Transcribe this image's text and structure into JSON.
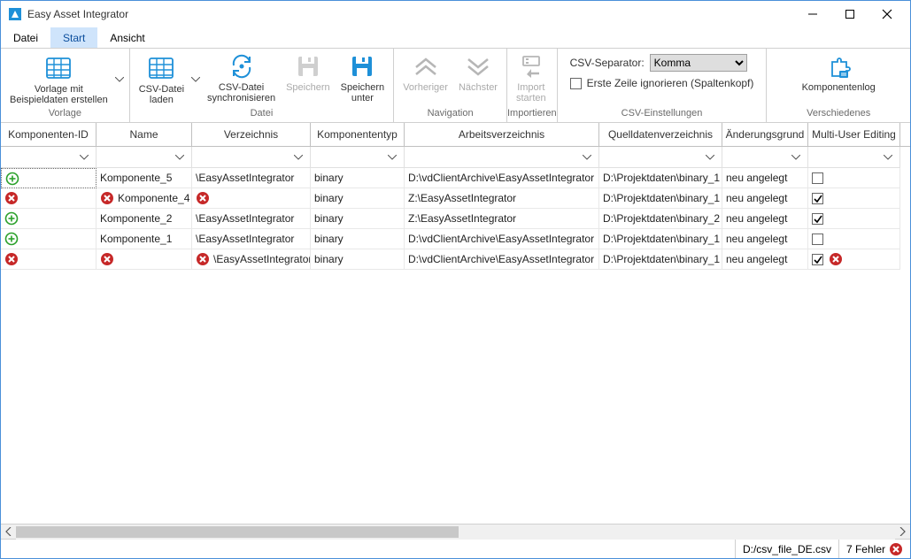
{
  "window": {
    "title": "Easy Asset Integrator"
  },
  "menu": {
    "items": [
      "Datei",
      "Start",
      "Ansicht"
    ],
    "active": 1
  },
  "ribbon": {
    "groups": {
      "vorlage": {
        "caption": "Vorlage",
        "btn_template": "Vorlage mit\nBeispieldaten erstellen"
      },
      "datei": {
        "caption": "Datei",
        "btn_load": "CSV-Datei\nladen",
        "btn_sync": "CSV-Datei\nsynchronisieren",
        "btn_save": "Speichern",
        "btn_saveas": "Speichern\nunter"
      },
      "nav": {
        "caption": "Navigation",
        "btn_prev": "Vorheriger",
        "btn_next": "Nächster"
      },
      "import": {
        "caption": "Importieren",
        "btn_start": "Import\nstarten"
      },
      "csv": {
        "caption": "CSV-Einstellungen",
        "sep_label": "CSV-Separator:",
        "sep_value": "Komma",
        "skip_label": "Erste Zeile ignorieren (Spaltenkopf)"
      },
      "misc": {
        "caption": "Verschiedenes",
        "btn_log": "Komponentenlog"
      }
    }
  },
  "grid": {
    "columns": {
      "id": "Komponenten-ID",
      "name": "Name",
      "dir": "Verzeichnis",
      "type": "Komponententyp",
      "work": "Arbeitsverzeichnis",
      "src": "Quelldatenverzeichnis",
      "reason": "Änderungsgrund",
      "multi": "Multi-User Editing"
    },
    "rows": [
      {
        "status": "plus",
        "name_icon": "",
        "name": "Komponente_5",
        "dir_icon": "",
        "dir": "\\EasyAssetIntegrator",
        "type": "binary",
        "work": "D:\\vdClientArchive\\EasyAssetIntegrator",
        "src": "D:\\Projektdaten\\binary_1",
        "reason": "neu angelegt",
        "multi": false,
        "tail_icon": ""
      },
      {
        "status": "error",
        "name_icon": "error",
        "name": "Komponente_4",
        "dir_icon": "error",
        "dir": "",
        "type": "binary",
        "work": "Z:\\EasyAssetIntegrator",
        "src": "D:\\Projektdaten\\binary_1",
        "reason": "neu angelegt",
        "multi": true,
        "tail_icon": ""
      },
      {
        "status": "plus",
        "name_icon": "",
        "name": "Komponente_2",
        "dir_icon": "",
        "dir": "\\EasyAssetIntegrator",
        "type": "binary",
        "work": "Z:\\EasyAssetIntegrator",
        "src": "D:\\Projektdaten\\binary_2",
        "reason": "neu angelegt",
        "multi": true,
        "tail_icon": ""
      },
      {
        "status": "plus",
        "name_icon": "",
        "name": "Komponente_1",
        "dir_icon": "",
        "dir": "\\EasyAssetIntegrator",
        "type": "binary",
        "work": "D:\\vdClientArchive\\EasyAssetIntegrator",
        "src": "D:\\Projektdaten\\binary_1",
        "reason": "neu angelegt",
        "multi": false,
        "tail_icon": ""
      },
      {
        "status": "error",
        "name_icon": "error",
        "name": "",
        "dir_icon": "error",
        "dir": "\\EasyAssetIntegrator",
        "type": "binary",
        "work": "D:\\vdClientArchive\\EasyAssetIntegrator",
        "src": "D:\\Projektdaten\\binary_1",
        "reason": "neu angelegt",
        "multi": true,
        "tail_icon": "error"
      }
    ]
  },
  "status": {
    "file": "D:/csv_file_DE.csv",
    "errors": "7 Fehler"
  },
  "colors": {
    "accent": "#1e90d8",
    "error": "#c62828",
    "add": "#2aa02a",
    "disabled": "#b6b6b6"
  }
}
